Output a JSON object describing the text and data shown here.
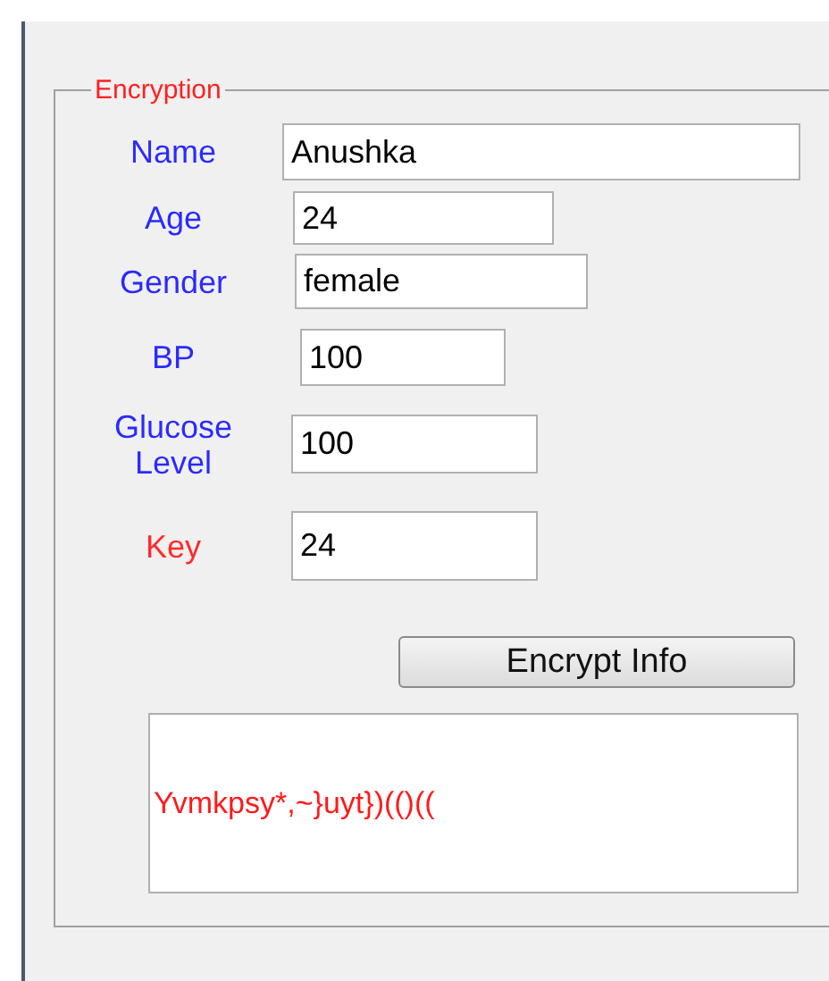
{
  "panel": {
    "title": "Encryption"
  },
  "fields": [
    {
      "label": "Name",
      "value": "Anushka",
      "color": "#2a2aff"
    },
    {
      "label": "Age",
      "value": "24",
      "color": "#2a2aff"
    },
    {
      "label": "Gender",
      "value": "female",
      "color": "#2a2aff"
    },
    {
      "label": "BP",
      "value": "100",
      "color": "#2a2aff"
    },
    {
      "label": "Glucose Level",
      "value": "100",
      "color": "#2a2aff"
    },
    {
      "label": "Key",
      "value": "24",
      "color": "#ff2a2a"
    }
  ],
  "button": {
    "label": "Encrypt Info"
  },
  "output": {
    "text": "Yvmkpsy*,~}uyt})(()(("
  }
}
